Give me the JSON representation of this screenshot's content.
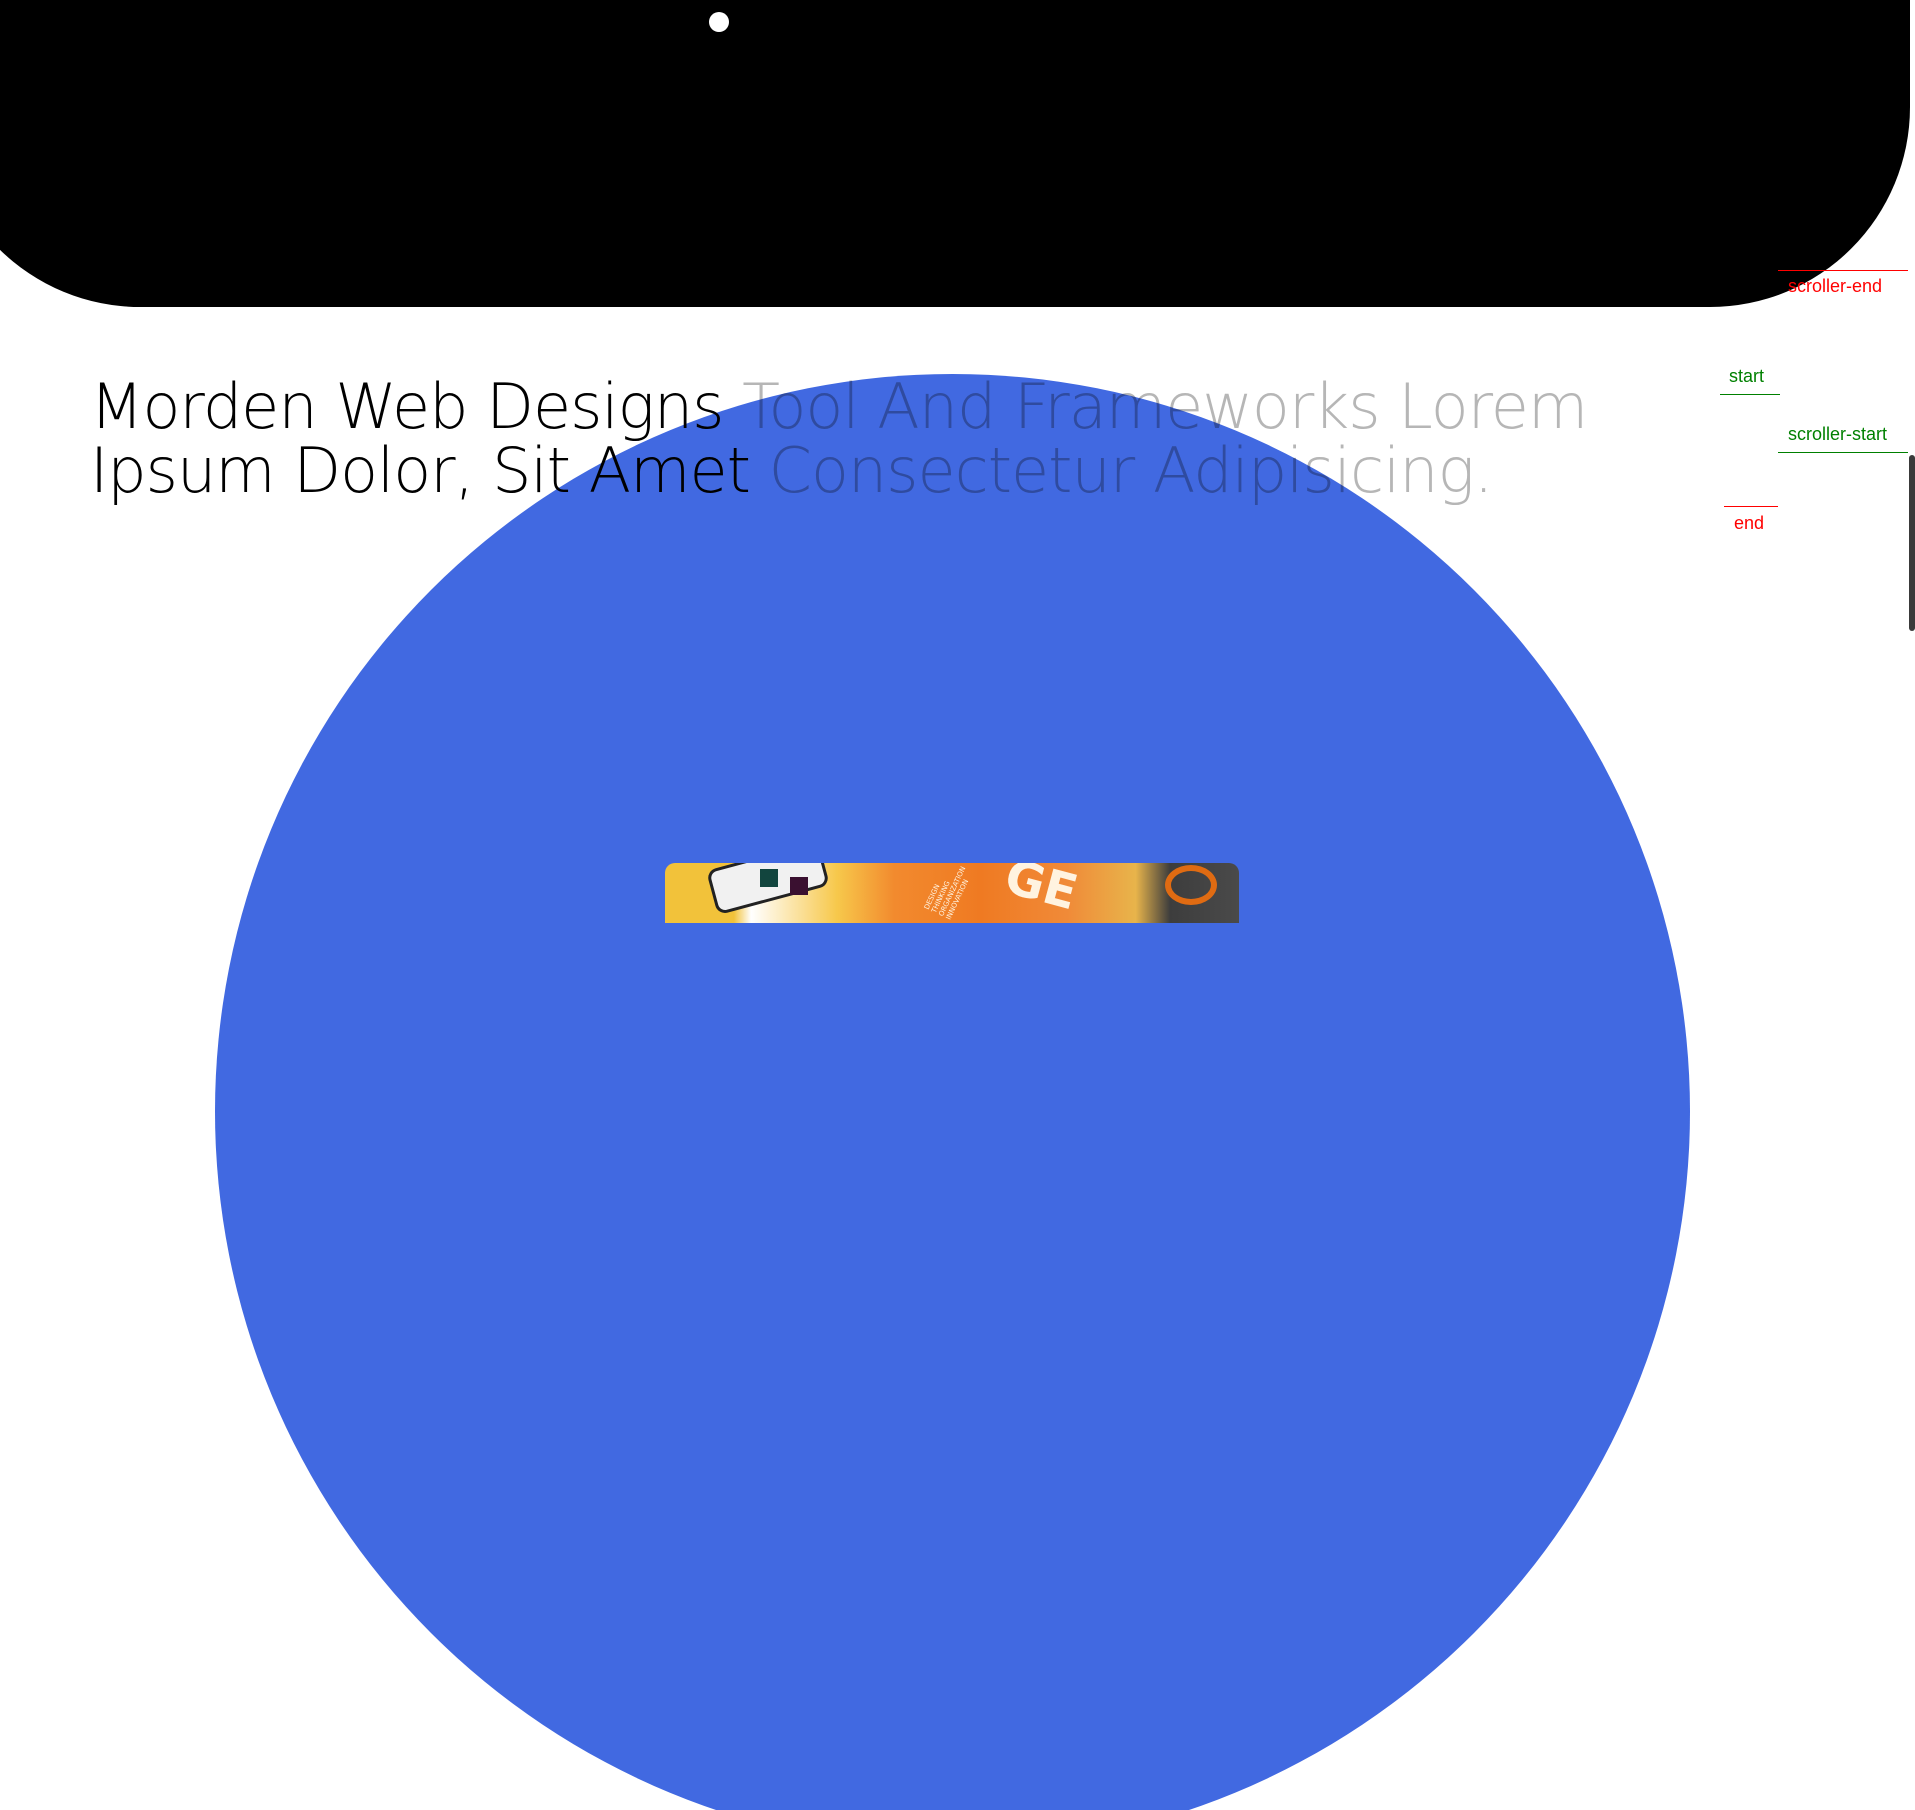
{
  "hero": {
    "background_color": "#000000"
  },
  "cursor": {
    "color": "#ffffff"
  },
  "heading": {
    "line1_dark": "Morden Web Designs",
    "line1_light": " Tool And Frameworks Lorem",
    "line2_dark": "Ipsum Dolor, Sit Amet",
    "line2_light": " Consectetur Adipisicing."
  },
  "accent_color": "#4169e1",
  "photo": {
    "logo_text": "GE",
    "caption_text": "DESIGN THINKING ORGANIZATION INNOVATION"
  },
  "scroll_markers": {
    "scroller_end": "scroller-end",
    "start": "start",
    "scroller_start": "scroller-start",
    "end": "end",
    "start_color": "#008000",
    "end_color": "#ff0000"
  }
}
